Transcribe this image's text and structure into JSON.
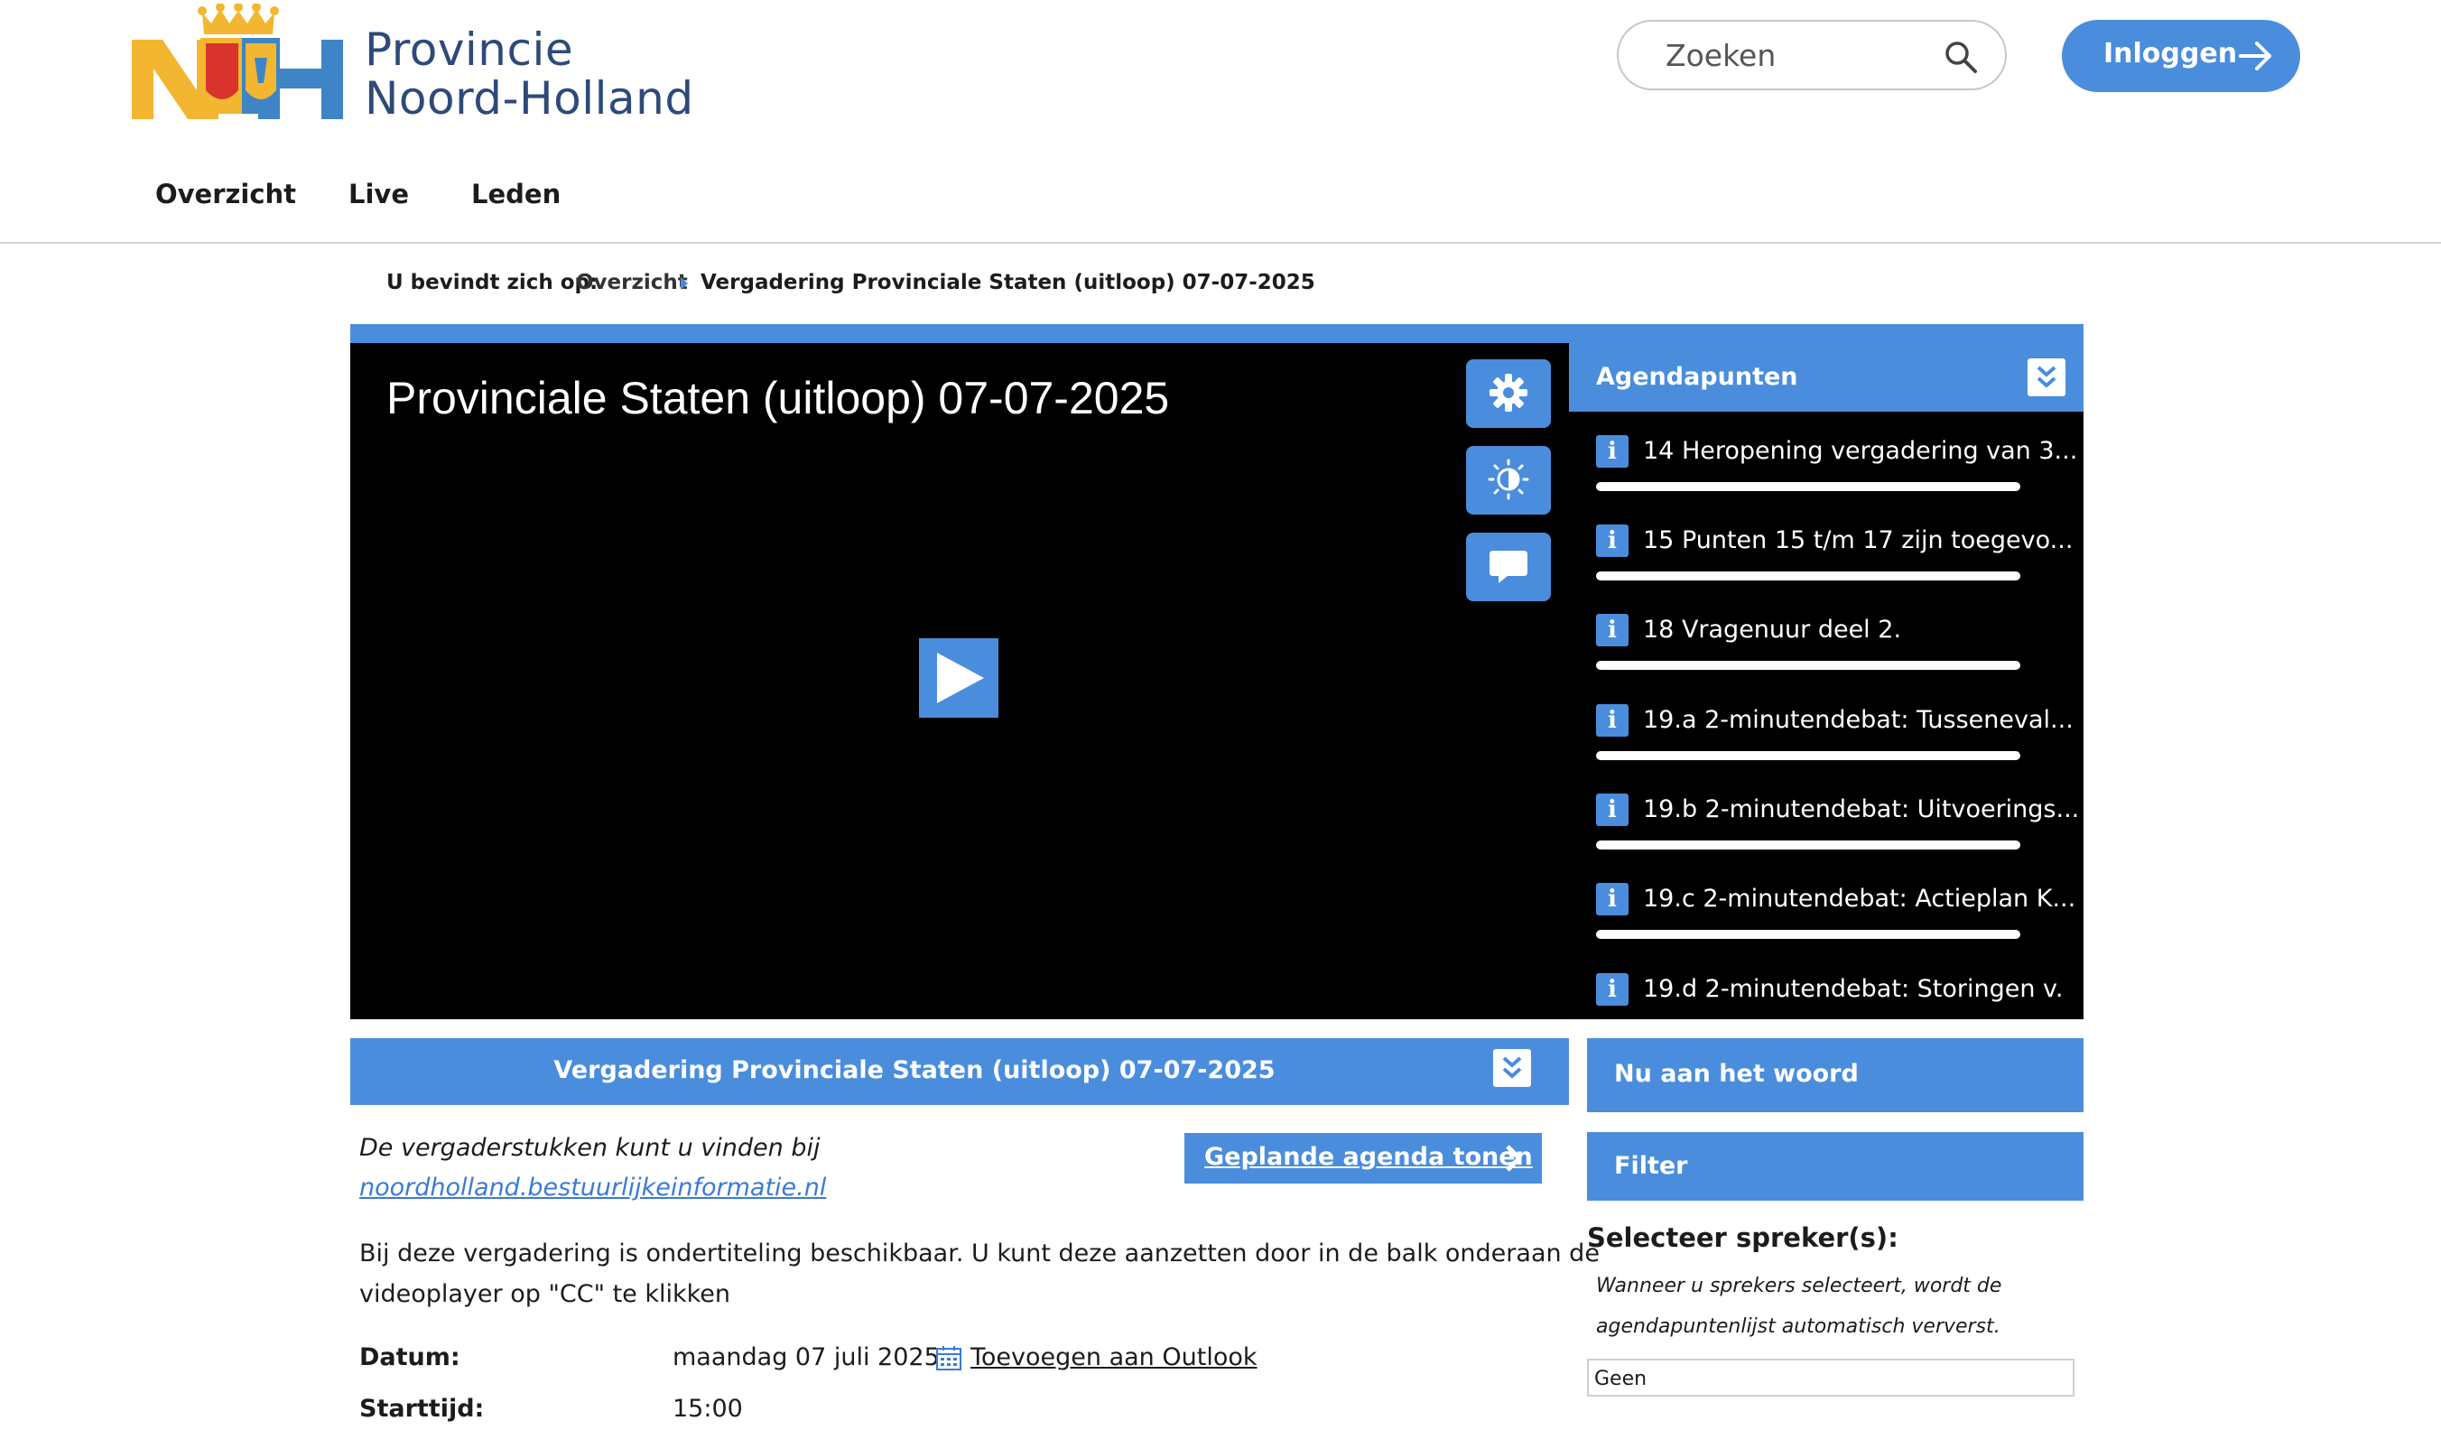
{
  "header": {
    "brand_line1": "Provincie",
    "brand_line2": "Noord-Holland",
    "search_placeholder": "Zoeken",
    "login_label": "Inloggen"
  },
  "nav": {
    "items": [
      "Overzicht",
      "Live",
      "Leden"
    ]
  },
  "breadcrumb": {
    "prefix": "U bevindt zich op:",
    "home": "Overzicht",
    "current": "Vergadering Provinciale Staten (uitloop) 07-07-2025"
  },
  "player": {
    "title": "Provinciale Staten (uitloop) 07-07-2025",
    "buttons": [
      "gear-icon",
      "brightness-icon",
      "chat-bubble-icon"
    ]
  },
  "agenda": {
    "title": "Agendapunten",
    "items": [
      {
        "label": "14 Heropening vergadering van 3..."
      },
      {
        "label": "15 Punten 15 t/m 17 zijn toegevo..."
      },
      {
        "label": "18 Vragenuur deel 2."
      },
      {
        "label": "19.a 2-minutendebat: Tusseneval..."
      },
      {
        "label": "19.b 2-minutendebat: Uitvoerings..."
      },
      {
        "label": "19.c 2-minutendebat: Actieplan K..."
      },
      {
        "label": "19.d 2-minutendebat: Storingen v..."
      }
    ]
  },
  "meeting": {
    "bar_title": "Vergadering Provinciale Staten (uitloop) 07-07-2025",
    "docs_text": "De vergaderstukken kunt u vinden bij",
    "docs_link": "noordholland.bestuurlijkeinformatie.nl",
    "agenda_button": "Geplande agenda tonen",
    "subtitle_line1": "Bij deze vergadering is ondertiteling beschikbaar. U kunt deze aanzetten door in de balk onderaan de",
    "subtitle_line2": "videoplayer op \"CC\" te klikken",
    "date_label": "Datum:",
    "date_value": "maandag 07 juli 2025",
    "outlook_link": "Toevoegen aan Outlook",
    "start_label": "Starttijd:",
    "start_value": "15:00"
  },
  "sidebar": {
    "now_speaking": "Nu aan het woord",
    "filter": "Filter",
    "select_label": "Selecteer spreker(s):",
    "hint_line1": "Wanneer u sprekers selecteert, wordt de",
    "hint_line2": "agendapuntenlijst automatisch ververst.",
    "select_value": "Geen"
  },
  "colors": {
    "accent": "#4a8ddc",
    "brand_text": "#2d4a78",
    "logo_yellow": "#f2b630",
    "logo_blue": "#3d85c6"
  }
}
